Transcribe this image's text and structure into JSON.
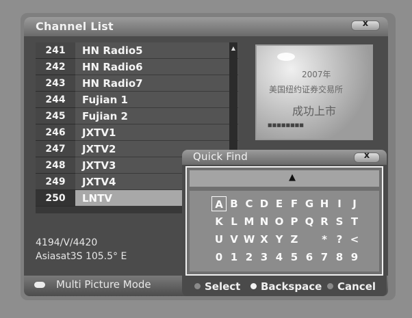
{
  "channel_list": {
    "title": "Channel List",
    "close_label": "x",
    "rows": [
      {
        "num": "241",
        "name": "HN Radio5"
      },
      {
        "num": "242",
        "name": "HN Radio6"
      },
      {
        "num": "243",
        "name": "HN Radio7"
      },
      {
        "num": "244",
        "name": "Fujian 1"
      },
      {
        "num": "245",
        "name": "Fujian 2"
      },
      {
        "num": "246",
        "name": "JXTV1"
      },
      {
        "num": "247",
        "name": "JXTV2"
      },
      {
        "num": "248",
        "name": "JXTV3"
      },
      {
        "num": "249",
        "name": "JXTV4"
      },
      {
        "num": "250",
        "name": "LNTV"
      }
    ],
    "selected_index": 9,
    "info_line1": "4194/V/4420",
    "info_line2": "Asiasat3S 105.5° E",
    "preview": {
      "line1": "2007年",
      "line2": "美国纽约证券交易所",
      "line3": "成功上市",
      "line4": "■■■■■■■■"
    }
  },
  "bottom_bar": {
    "multi_picture_label": "Multi Picture Mode"
  },
  "quick_find": {
    "title": "Quick Find",
    "close_label": "x",
    "cursor": "▲",
    "selected_key": "A",
    "rows": [
      [
        "A",
        "B",
        "C",
        "D",
        "E",
        "F",
        "G",
        "H",
        "I",
        "J"
      ],
      [
        "K",
        "L",
        "M",
        "N",
        "O",
        "P",
        "Q",
        "R",
        "S",
        "T"
      ],
      [
        "U",
        "V",
        "W",
        "X",
        "Y",
        "Z",
        "",
        "*",
        "?",
        "<"
      ],
      [
        "0",
        "1",
        "2",
        "3",
        "4",
        "5",
        "6",
        "7",
        "8",
        "9"
      ]
    ],
    "select_label": "Select",
    "backspace_label": "Backspace",
    "cancel_label": "Cancel"
  },
  "colors": {
    "background": "#8e8e8e",
    "selected_row": "#a8a8a8",
    "button_dot": "#bdbdbd"
  }
}
